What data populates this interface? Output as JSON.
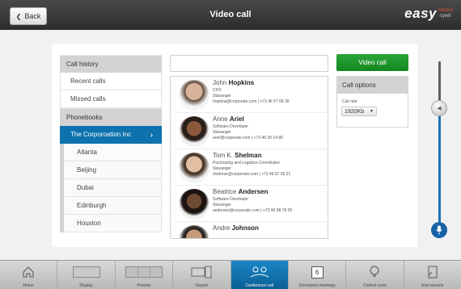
{
  "header": {
    "back_label": "Back",
    "title": "Video call",
    "logo_word": "easy",
    "logo_sub_a": "control",
    "logo_sub_b": "·cywit"
  },
  "nav": {
    "call_history": "Call history",
    "recent_calls": "Recent calls",
    "missed_calls": "Missed calls",
    "phonebooks": "Phonebooks",
    "active_book": "The Corporoation Inc",
    "locations": [
      "Atlanta",
      "Beijing",
      "Dubai",
      "Edinburgh",
      "Houston"
    ]
  },
  "contacts": [
    {
      "first": "John",
      "last": "Hopkins",
      "role": "CFO",
      "location": "Stavanger",
      "contact": "hopkins@corporate.com | +73 46 57 68 39"
    },
    {
      "first": "Anne",
      "last": "Ariel",
      "role": "Software Developer",
      "location": "Stavanger",
      "contact": "ariel@corporate.com | +73 46 39 14 80"
    },
    {
      "first": "Tom K.",
      "last": "Shelman",
      "role": "Purchasing and Logistics Coordinator",
      "location": "Stavanger",
      "contact": "shelman@corporate.com | +73 46 67 05 21"
    },
    {
      "first": "Beatrice",
      "last": "Andersen",
      "role": "Software Developer",
      "location": "Stavanger",
      "contact": "andersen@corporate.com | +73 46 98 78 05"
    },
    {
      "first": "Andre",
      "last": "Johnson",
      "role": "",
      "location": "",
      "contact": ""
    }
  ],
  "actions": {
    "video_call": "Video call",
    "call_options": "Call options",
    "call_rate_label": "Call rate",
    "call_rate_value": "1920Kb"
  },
  "volume": {
    "level": 0.72
  },
  "bottom_nav": [
    {
      "label": "Home"
    },
    {
      "label": "Display"
    },
    {
      "label": "Presets"
    },
    {
      "label": "Targets"
    },
    {
      "label": "Conference call"
    },
    {
      "label": "Scheduled meetings",
      "badge": "6"
    },
    {
      "label": "Control room"
    },
    {
      "label": "End session"
    }
  ],
  "colors": {
    "accent": "#0d72ad",
    "green": "#1d9a2c",
    "header": "#3a3a3a"
  }
}
